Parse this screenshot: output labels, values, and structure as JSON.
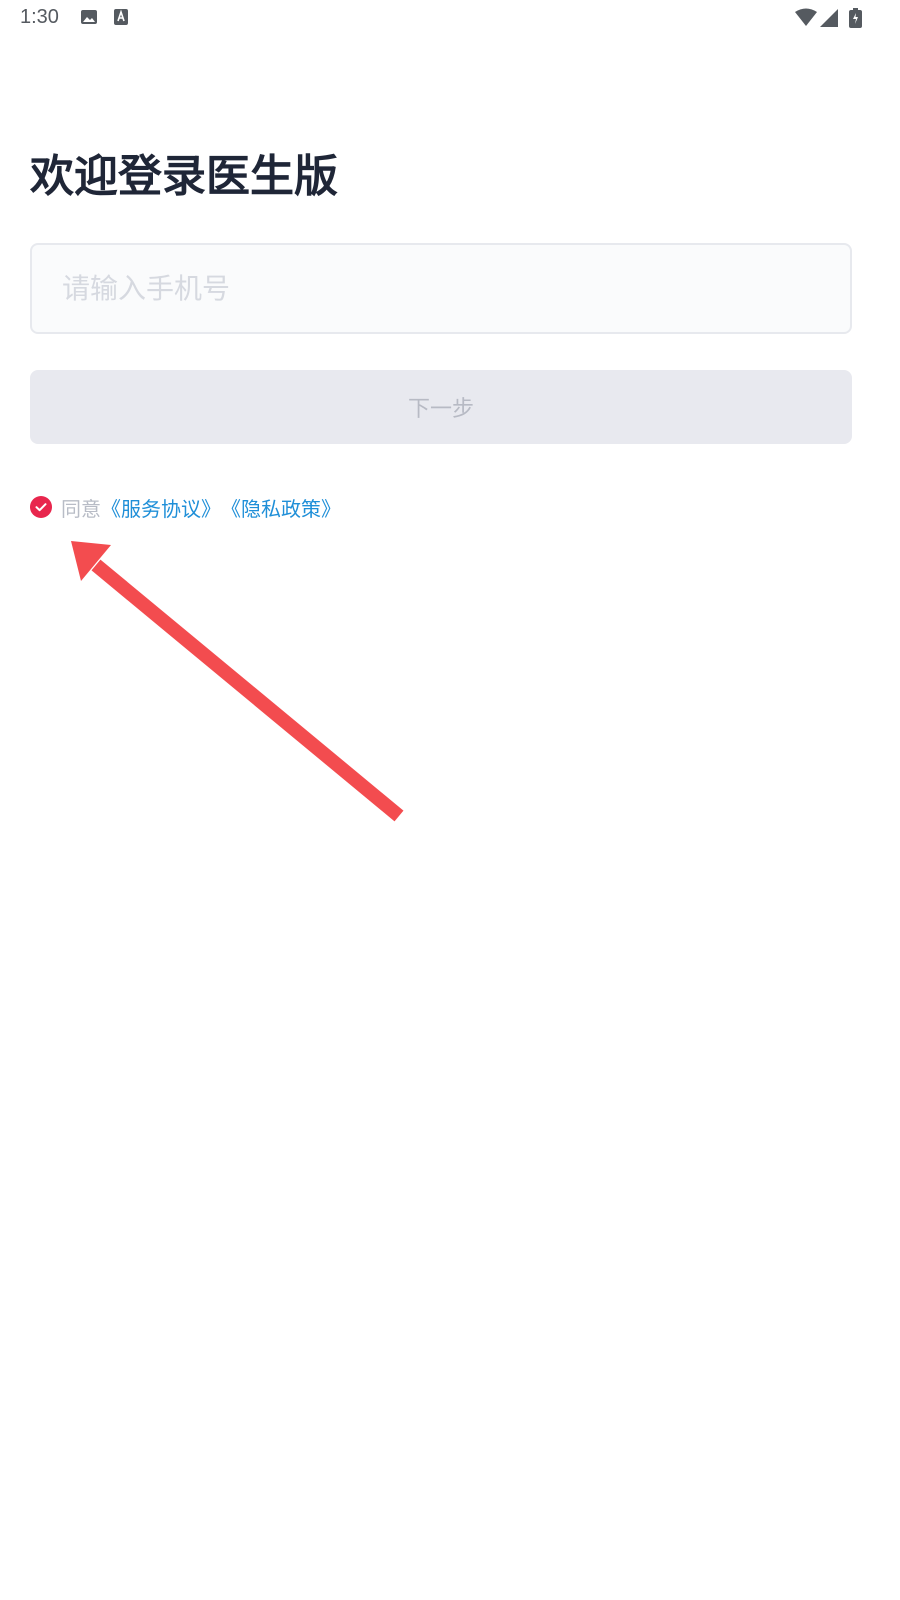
{
  "status_bar": {
    "time": "1:30",
    "icons": [
      "image-icon",
      "text-a-icon",
      "wifi-icon",
      "signal-icon",
      "battery-charging-icon"
    ]
  },
  "login": {
    "title": "欢迎登录医生版",
    "phone_placeholder": "请输入手机号",
    "next_label": "下一步",
    "agree_prefix": "同意",
    "service_link": "《服务协议》",
    "privacy_link": "《隐私政策》",
    "agreed": true
  },
  "colors": {
    "title": "#1f2637",
    "link": "#1f8fd8",
    "checkbox": "#e8264d",
    "annotation_arrow": "#f34c4f",
    "button_bg": "#e8e9ef"
  }
}
